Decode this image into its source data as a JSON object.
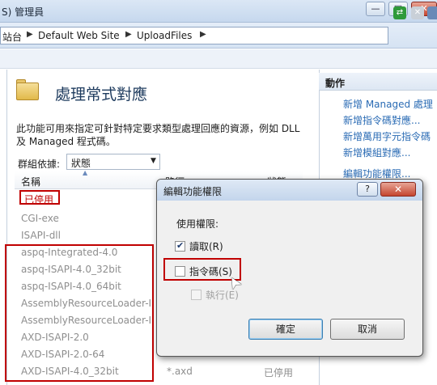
{
  "window": {
    "title": "S) 管理員",
    "buttons": [
      "—",
      "□",
      "✕"
    ]
  },
  "address": {
    "crumbs": [
      "站台",
      "Default Web Site",
      "UploadFiles"
    ],
    "sep": "▶"
  },
  "main": {
    "title": "處理常式對應",
    "description_line1": "此功能可用來指定可針對特定要求類型處理回應的資源，例如 DLL",
    "description_line2": "及 Managed 程式碼。",
    "group_label": "群組依據:",
    "group_value": "狀態",
    "columns": {
      "name": "名稱",
      "path": "路徑",
      "state": "狀態"
    },
    "group_row": "已停用",
    "rows": [
      "CGI-exe",
      "ISAPI-dll",
      "aspq-Integrated-4.0",
      "aspq-ISAPI-4.0_32bit",
      "aspq-ISAPI-4.0_64bit",
      "AssemblyResourceLoader-In...",
      "AssemblyResourceLoader-In...",
      "AXD-ISAPI-2.0",
      "AXD-ISAPI-2.0-64",
      "AXD-ISAPI-4.0_32bit"
    ],
    "last_row_path": "*.axd",
    "last_row_state": "已停用"
  },
  "actions": {
    "title": "動作",
    "links": [
      "新增 Managed 處理",
      "新增指令碼對應...",
      "新增萬用字元指令碼",
      "新增模組對應...",
      "編輯功能權限..."
    ]
  },
  "dialog": {
    "title": "編輯功能權限",
    "help": "?",
    "close": "✕",
    "perm_label": "使用權限:",
    "read": "讀取(R)",
    "read_checked": true,
    "script": "指令碼(S)",
    "script_checked": false,
    "exec": "執行(E)",
    "exec_checked": false,
    "ok": "確定",
    "cancel": "取消"
  },
  "colors": {
    "highlight": "#c00000",
    "link": "#2a6bb4",
    "title": "#1e3b5e"
  }
}
